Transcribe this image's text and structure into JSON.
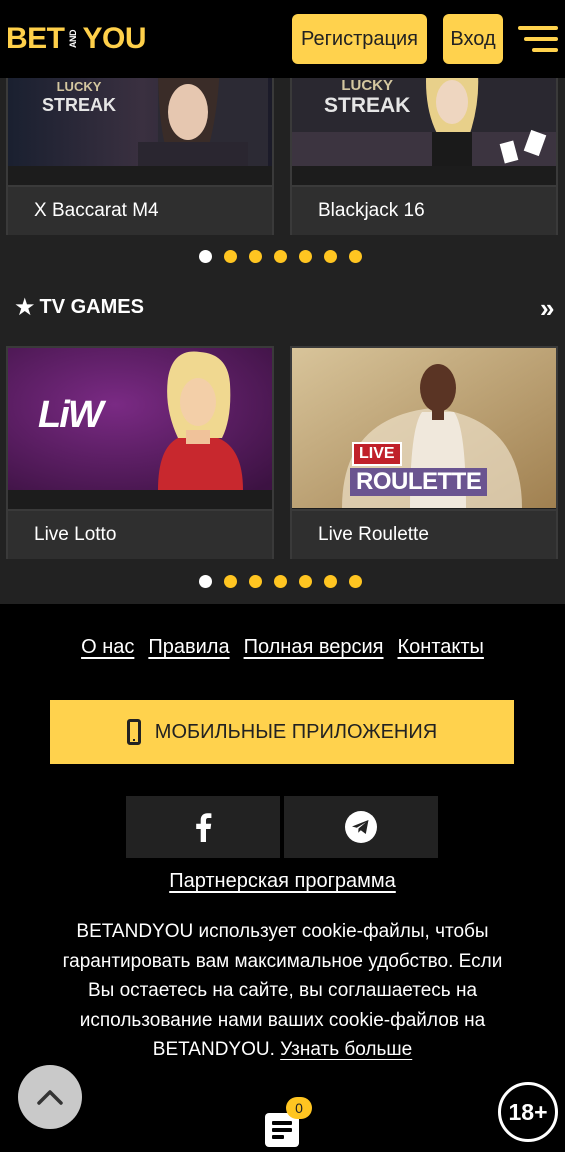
{
  "header": {
    "logo_bet": "BET",
    "logo_and_1": "AND",
    "logo_you": "YOU",
    "register_label": "Регистрация",
    "login_label": "Вход"
  },
  "casino": {
    "cards": [
      {
        "label": "X Baccarat M4",
        "badge_1": "LUCKY",
        "badge_2": "STREAK"
      },
      {
        "label": "Blackjack 16",
        "badge_1": "LUCKY",
        "badge_2": "STREAK"
      }
    ]
  },
  "tv_games": {
    "title": "TV GAMES",
    "more": "»",
    "cards": [
      {
        "label": "Live Lotto",
        "logo_text": "LiW"
      },
      {
        "label": "Live Roulette",
        "badge_live": "LIVE",
        "badge_roulette": "ROULETTE"
      }
    ]
  },
  "carousel": {
    "pages": 7,
    "active": 0
  },
  "footer": {
    "links": [
      "О нас",
      "Правила",
      "Полная версия",
      "Контакты"
    ],
    "mobile_apps_label": "МОБИЛЬНЫЕ ПРИЛОЖЕНИЯ",
    "social": [
      "facebook-icon",
      "telegram-icon"
    ],
    "partner_label": "Партнерская программа",
    "cookie_text": "BETANDYOU использует cookie-файлы, чтобы гарантировать вам максимальное удобство. Если Вы остаетесь на сайте, вы соглашаетесь на использование нами ваших cookie-файлов на BETANDYOU.",
    "cookie_link": "Узнать больше",
    "betslip_count": "0",
    "age_label": "18+"
  },
  "colors": {
    "accent": "#ffd24d",
    "dot": "#ffc521",
    "section_bg": "#222222",
    "page_bg": "#000000"
  }
}
